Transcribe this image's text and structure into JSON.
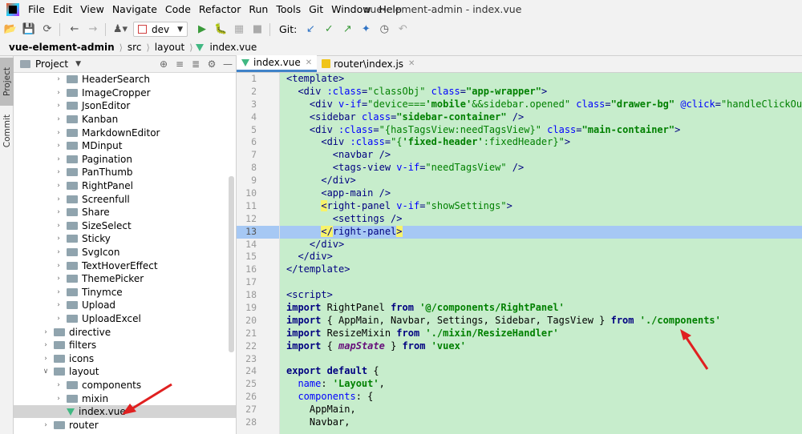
{
  "menu": {
    "items": [
      "File",
      "Edit",
      "View",
      "Navigate",
      "Code",
      "Refactor",
      "Run",
      "Tools",
      "Git",
      "Window",
      "Help"
    ],
    "window_title": "vue-element-admin - index.vue"
  },
  "toolbar": {
    "branch": "dev",
    "git_label": "Git:"
  },
  "breadcrumb": {
    "project": "vue-element-admin",
    "items": [
      "src",
      "layout",
      "index.vue"
    ]
  },
  "tool_strip": {
    "project": "Project",
    "commit": "Commit"
  },
  "project_panel": {
    "title": "Project",
    "tree": [
      {
        "label": "HeaderSearch",
        "depth": 3,
        "type": "folder",
        "expanded": false
      },
      {
        "label": "ImageCropper",
        "depth": 3,
        "type": "folder",
        "expanded": false
      },
      {
        "label": "JsonEditor",
        "depth": 3,
        "type": "folder",
        "expanded": false
      },
      {
        "label": "Kanban",
        "depth": 3,
        "type": "folder",
        "expanded": false
      },
      {
        "label": "MarkdownEditor",
        "depth": 3,
        "type": "folder",
        "expanded": false
      },
      {
        "label": "MDinput",
        "depth": 3,
        "type": "folder",
        "expanded": false
      },
      {
        "label": "Pagination",
        "depth": 3,
        "type": "folder",
        "expanded": false
      },
      {
        "label": "PanThumb",
        "depth": 3,
        "type": "folder",
        "expanded": false
      },
      {
        "label": "RightPanel",
        "depth": 3,
        "type": "folder",
        "expanded": false
      },
      {
        "label": "Screenfull",
        "depth": 3,
        "type": "folder",
        "expanded": false
      },
      {
        "label": "Share",
        "depth": 3,
        "type": "folder",
        "expanded": false
      },
      {
        "label": "SizeSelect",
        "depth": 3,
        "type": "folder",
        "expanded": false
      },
      {
        "label": "Sticky",
        "depth": 3,
        "type": "folder",
        "expanded": false
      },
      {
        "label": "SvgIcon",
        "depth": 3,
        "type": "folder",
        "expanded": false
      },
      {
        "label": "TextHoverEffect",
        "depth": 3,
        "type": "folder",
        "expanded": false
      },
      {
        "label": "ThemePicker",
        "depth": 3,
        "type": "folder",
        "expanded": false
      },
      {
        "label": "Tinymce",
        "depth": 3,
        "type": "folder",
        "expanded": false
      },
      {
        "label": "Upload",
        "depth": 3,
        "type": "folder",
        "expanded": false
      },
      {
        "label": "UploadExcel",
        "depth": 3,
        "type": "folder",
        "expanded": false
      },
      {
        "label": "directive",
        "depth": 2,
        "type": "folder",
        "expanded": false
      },
      {
        "label": "filters",
        "depth": 2,
        "type": "folder",
        "expanded": false
      },
      {
        "label": "icons",
        "depth": 2,
        "type": "folder",
        "expanded": false
      },
      {
        "label": "layout",
        "depth": 2,
        "type": "folder",
        "expanded": true
      },
      {
        "label": "components",
        "depth": 3,
        "type": "folder",
        "expanded": false
      },
      {
        "label": "mixin",
        "depth": 3,
        "type": "folder",
        "expanded": false
      },
      {
        "label": "index.vue",
        "depth": 3,
        "type": "vue",
        "selected": true
      },
      {
        "label": "router",
        "depth": 2,
        "type": "folder",
        "expanded": false
      }
    ]
  },
  "editor": {
    "tabs": [
      {
        "label": "index.vue",
        "active": true
      },
      {
        "label": "router\\index.js",
        "active": false
      }
    ],
    "current_line": 13,
    "line_numbers": [
      "1",
      "2",
      "3",
      "4",
      "5",
      "6",
      "7",
      "8",
      "9",
      "10",
      "11",
      "12",
      "13",
      "14",
      "15",
      "16",
      "17",
      "18",
      "19",
      "20",
      "21",
      "22",
      "23",
      "24",
      "25",
      "26",
      "27",
      "28"
    ]
  },
  "colors": {
    "editor_bg": "#c7edcc",
    "current_line": "#a6c8f4",
    "arrow": "#e02020",
    "vue_green": "#41b883"
  }
}
